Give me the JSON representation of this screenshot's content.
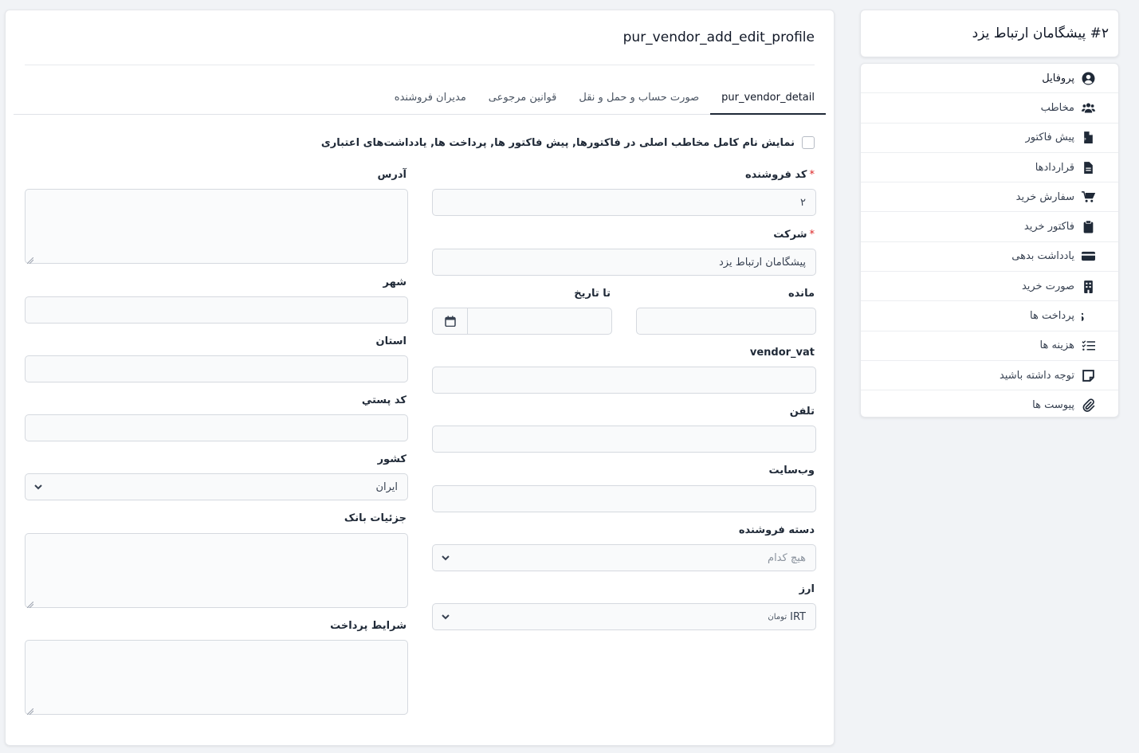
{
  "sidebar": {
    "title": "#۲ پیشگامان ارتباط یزد",
    "items": [
      {
        "label": "پروفایل",
        "icon": "user-circle-icon"
      },
      {
        "label": "مخاطب",
        "icon": "users-icon"
      },
      {
        "label": "پیش فاکتور",
        "icon": "file-invoice-icon"
      },
      {
        "label": "قراردادها",
        "icon": "file-contract-icon"
      },
      {
        "label": "سفارش خرید",
        "icon": "cart-icon"
      },
      {
        "label": "فاکتور خرید",
        "icon": "clipboard-icon"
      },
      {
        "label": "یادداشت بدهی",
        "icon": "credit-card-icon"
      },
      {
        "label": "صورت خرید",
        "icon": "building-icon"
      },
      {
        "label": "پرداخت ها",
        "icon": "dollar-icon"
      },
      {
        "label": "هزینه ها",
        "icon": "list-check-icon"
      },
      {
        "label": "توجه داشته باشید",
        "icon": "note-icon"
      },
      {
        "label": "پیوست ها",
        "icon": "paperclip-icon"
      }
    ]
  },
  "main": {
    "title": "pur_vendor_add_edit_profile",
    "tabs": [
      "pur_vendor_detail",
      "صورت حساب و حمل و نقل",
      "قوانین مرجوعی",
      "مدیران فروشنده"
    ],
    "checkbox_label": "نمایش نام کامل مخاطب اصلی در فاکتورها, پیش فاکتور ها, پرداخت ها, یادداشت‌های اعتباری",
    "fields": {
      "vendor_code": {
        "label": "کد فروشنده",
        "value": "۲"
      },
      "company": {
        "label": "شرکت",
        "value": "پیشگامان ارتباط یزد"
      },
      "balance": {
        "label": "مانده",
        "value": ""
      },
      "to_date": {
        "label": "تا تاریخ",
        "value": ""
      },
      "vendor_vat": {
        "label": "vendor_vat",
        "value": ""
      },
      "phone": {
        "label": "تلفن",
        "value": ""
      },
      "website": {
        "label": "وب‌سایت",
        "value": ""
      },
      "vendor_group": {
        "label": "دسته فروشنده",
        "placeholder": "هیچ کدام"
      },
      "currency": {
        "label": "ارز",
        "value": "IRT",
        "sub": "تومان"
      },
      "address": {
        "label": "آدرس",
        "value": ""
      },
      "city": {
        "label": "شهر",
        "value": ""
      },
      "state": {
        "label": "استان",
        "value": ""
      },
      "zip": {
        "label": "کد پستي",
        "value": ""
      },
      "country": {
        "label": "کشور",
        "value": "ایران"
      },
      "bank_details": {
        "label": "جزئیات بانک",
        "value": ""
      },
      "payment_terms": {
        "label": "شرایط پرداخت",
        "value": ""
      }
    }
  }
}
